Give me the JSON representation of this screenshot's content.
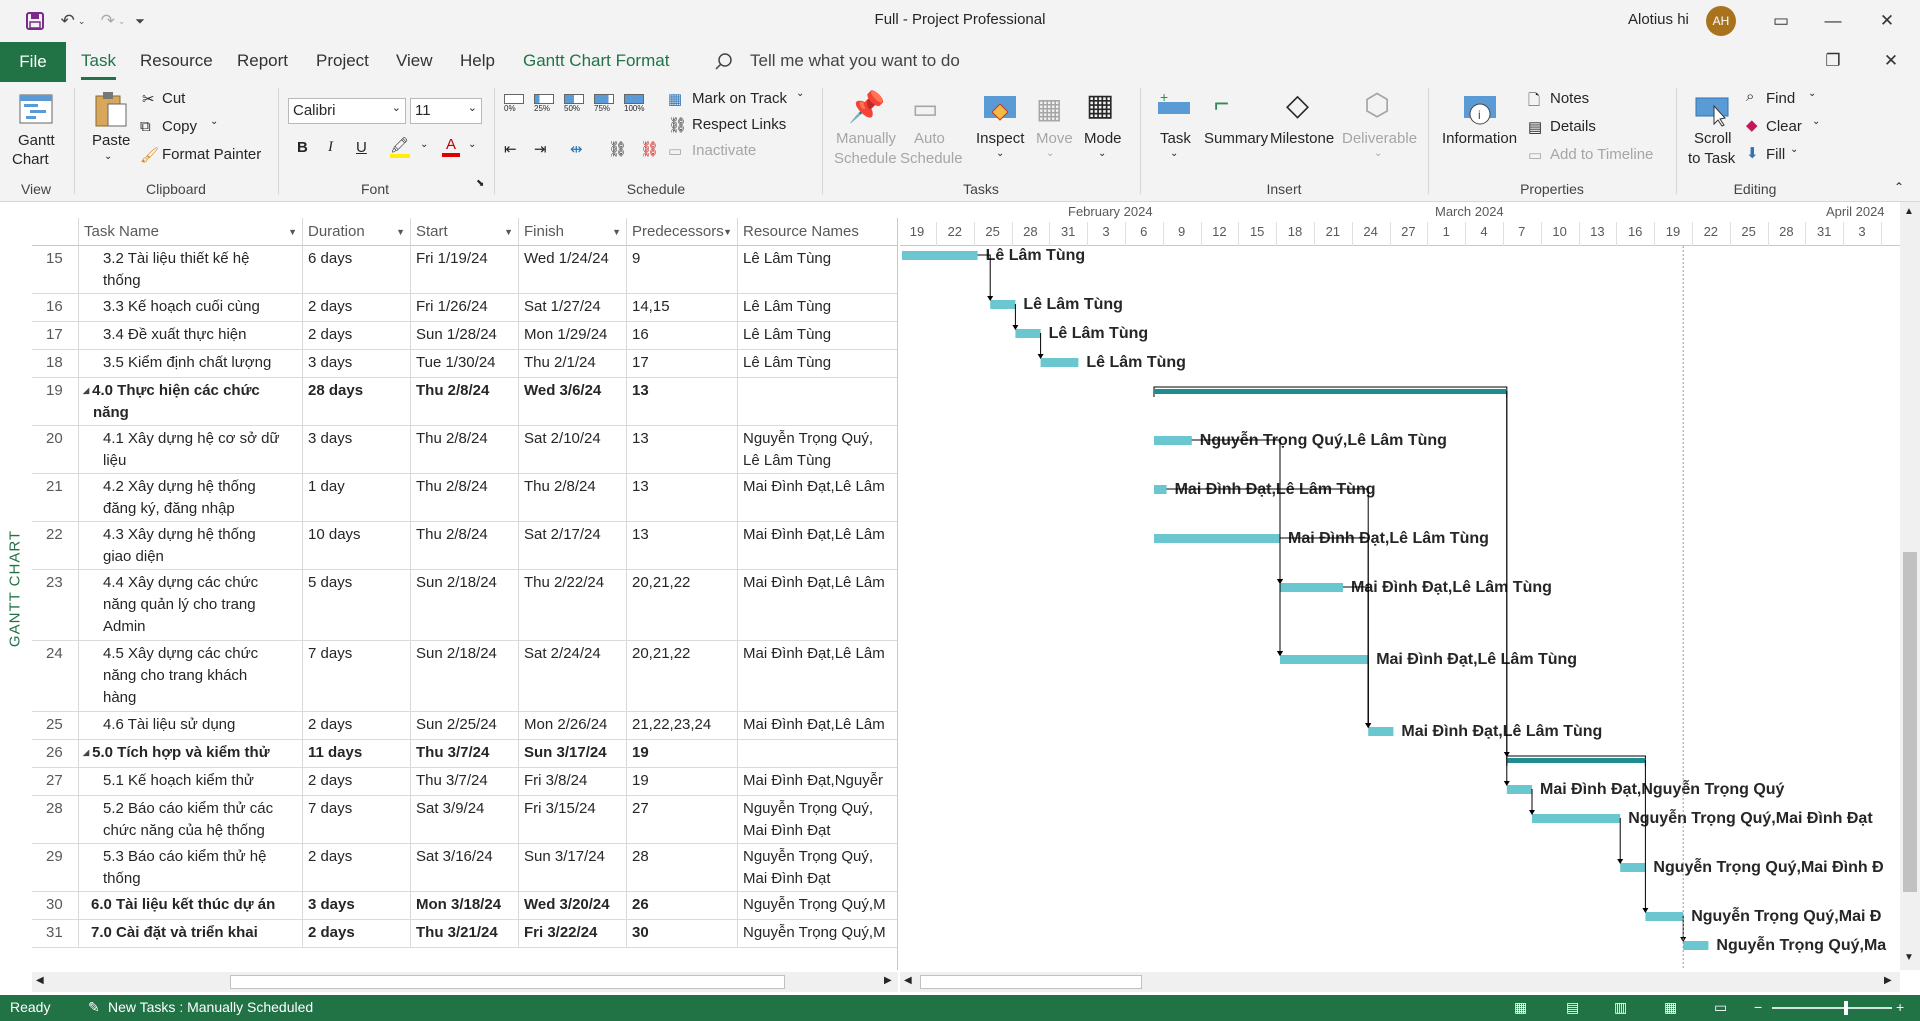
{
  "window": {
    "title": "Full  -  Project Professional",
    "user": "Alotius hi",
    "avatar_initials": "AH"
  },
  "menu": {
    "file": "File",
    "tabs": [
      "Task",
      "Resource",
      "Report",
      "Project",
      "View",
      "Help",
      "Gantt Chart Format"
    ],
    "tell_me": "Tell me what you want to do"
  },
  "ribbon": {
    "view": {
      "gantt_chart": "Gantt",
      "gantt_chart2": "Chart",
      "label": "View"
    },
    "clipboard": {
      "paste": "Paste",
      "cut": "Cut",
      "copy": "Copy",
      "format_painter": "Format Painter",
      "label": "Clipboard"
    },
    "font": {
      "name": "Calibri",
      "size": "11",
      "bold": "B",
      "italic": "I",
      "underline": "U",
      "label": "Font"
    },
    "schedule": {
      "pcts": [
        "0%",
        "25%",
        "50%",
        "75%",
        "100%"
      ],
      "mark_on_track": "Mark on Track",
      "respect_links": "Respect Links",
      "inactivate": "Inactivate",
      "label": "Schedule"
    },
    "tasks": {
      "manually_schedule": [
        "Manually",
        "Schedule"
      ],
      "auto_schedule": [
        "Auto",
        "Schedule"
      ],
      "inspect": "Inspect",
      "move": "Move",
      "mode": "Mode",
      "label": "Tasks"
    },
    "insert": {
      "task": "Task",
      "summary": "Summary",
      "milestone": "Milestone",
      "deliverable": "Deliverable",
      "label": "Insert"
    },
    "properties": {
      "information": "Information",
      "notes": "Notes",
      "details": "Details",
      "add_to_timeline": "Add to Timeline",
      "label": "Properties"
    },
    "editing": {
      "scroll": [
        "Scroll",
        "to Task"
      ],
      "find": "Find",
      "clear": "Clear",
      "fill": "Fill",
      "label": "Editing"
    }
  },
  "side_label": "GANTT CHART",
  "table": {
    "headers": [
      "Task Name",
      "Duration",
      "Start",
      "Finish",
      "Predecessors",
      "Resource Names"
    ],
    "rows": [
      {
        "id": "15",
        "name": [
          "3.2 Tài liệu thiết kế hệ",
          "thống"
        ],
        "dur": "6 days",
        "start": "Fri 1/19/24",
        "finish": "Wed 1/24/24",
        "pred": "9",
        "res": [
          "Lê Lâm Tùng"
        ]
      },
      {
        "id": "16",
        "name": [
          "3.3 Kế hoạch cuối cùng"
        ],
        "dur": "2 days",
        "start": "Fri 1/26/24",
        "finish": "Sat 1/27/24",
        "pred": "14,15",
        "res": [
          "Lê Lâm Tùng"
        ]
      },
      {
        "id": "17",
        "name": [
          "3.4 Đề xuất thực hiện"
        ],
        "dur": "2 days",
        "start": "Sun 1/28/24",
        "finish": "Mon 1/29/24",
        "pred": "16",
        "res": [
          "Lê Lâm Tùng"
        ]
      },
      {
        "id": "18",
        "name": [
          "3.5 Kiểm định chất lượng"
        ],
        "dur": "3 days",
        "start": "Tue 1/30/24",
        "finish": "Thu 2/1/24",
        "pred": "17",
        "res": [
          "Lê Lâm Tùng"
        ]
      },
      {
        "id": "19",
        "summary": true,
        "name": [
          "4.0 Thực hiện các chức",
          "năng"
        ],
        "dur": "28 days",
        "start": "Thu 2/8/24",
        "finish": "Wed 3/6/24",
        "pred": "13",
        "res": [
          ""
        ]
      },
      {
        "id": "20",
        "name": [
          "4.1 Xây dựng hệ cơ sở dữ",
          "liệu"
        ],
        "dur": "3 days",
        "start": "Thu 2/8/24",
        "finish": "Sat 2/10/24",
        "pred": "13",
        "res": [
          "Nguyễn Trọng Quý,",
          "Lê Lâm Tùng"
        ]
      },
      {
        "id": "21",
        "name": [
          "4.2 Xây dựng hệ thống",
          "đăng ký, đăng nhập"
        ],
        "dur": "1 day",
        "start": "Thu 2/8/24",
        "finish": "Thu 2/8/24",
        "pred": "13",
        "res": [
          "Mai Đình Đạt,Lê Lâm"
        ]
      },
      {
        "id": "22",
        "name": [
          "4.3 Xây dựng hệ thống",
          "giao diện"
        ],
        "dur": "10 days",
        "start": "Thu 2/8/24",
        "finish": "Sat 2/17/24",
        "pred": "13",
        "res": [
          "Mai Đình Đạt,Lê Lâm"
        ]
      },
      {
        "id": "23",
        "name": [
          "4.4 Xây dựng các chức",
          "năng quản lý cho trang",
          "Admin"
        ],
        "dur": "5 days",
        "start": "Sun 2/18/24",
        "finish": "Thu 2/22/24",
        "pred": "20,21,22",
        "res": [
          "Mai Đình Đạt,Lê Lâm"
        ]
      },
      {
        "id": "24",
        "name": [
          "4.5 Xây dựng các chức",
          "năng cho trang khách",
          "hàng"
        ],
        "dur": "7 days",
        "start": "Sun 2/18/24",
        "finish": "Sat 2/24/24",
        "pred": "20,21,22",
        "res": [
          "Mai Đình Đạt,Lê Lâm"
        ]
      },
      {
        "id": "25",
        "name": [
          "4.6 Tài liệu sử dụng"
        ],
        "dur": "2 days",
        "start": "Sun 2/25/24",
        "finish": "Mon 2/26/24",
        "pred": "21,22,23,24",
        "res": [
          "Mai Đình Đạt,Lê Lâm"
        ]
      },
      {
        "id": "26",
        "summary": true,
        "name": [
          "5.0 Tích hợp và kiểm thử"
        ],
        "dur": "11 days",
        "start": "Thu 3/7/24",
        "finish": "Sun 3/17/24",
        "pred": "19",
        "res": [
          ""
        ]
      },
      {
        "id": "27",
        "name": [
          "5.1 Kế hoạch kiểm thử"
        ],
        "dur": "2 days",
        "start": "Thu 3/7/24",
        "finish": "Fri 3/8/24",
        "pred": "19",
        "res": [
          "Mai Đình Đạt,Nguyễr"
        ]
      },
      {
        "id": "28",
        "name": [
          "5.2 Báo cáo kiểm thử các",
          "chức năng của hệ thống"
        ],
        "dur": "7 days",
        "start": "Sat 3/9/24",
        "finish": "Fri 3/15/24",
        "pred": "27",
        "res": [
          "Nguyễn Trọng Quý,",
          "Mai Đình Đạt"
        ]
      },
      {
        "id": "29",
        "name": [
          "5.3 Báo cáo kiểm thử hệ",
          "thống"
        ],
        "dur": "2 days",
        "start": "Sat 3/16/24",
        "finish": "Sun 3/17/24",
        "pred": "28",
        "res": [
          "Nguyễn Trọng Quý,",
          "Mai Đình Đạt"
        ]
      },
      {
        "id": "30",
        "summary": true,
        "nocollapse": true,
        "name": [
          "6.0 Tài liệu kết thúc dự án"
        ],
        "dur": "3 days",
        "start": "Mon 3/18/24",
        "finish": "Wed 3/20/24",
        "pred": "26",
        "res": [
          "Nguyễn Trọng Quý,M"
        ]
      },
      {
        "id": "31",
        "summary": true,
        "nocollapse": true,
        "name": [
          "7.0 Cài đặt và triển khai"
        ],
        "dur": "2 days",
        "start": "Thu 3/21/24",
        "finish": "Fri 3/22/24",
        "pred": "30",
        "res": [
          "Nguyễn Trọng Quý,M"
        ]
      }
    ]
  },
  "timeline": {
    "months": [
      "February 2024",
      "March 2024",
      "April 2024"
    ],
    "days": [
      "19",
      "22",
      "25",
      "28",
      "31",
      "3",
      "6",
      "9",
      "12",
      "15",
      "18",
      "21",
      "24",
      "27",
      "1",
      "4",
      "7",
      "10",
      "13",
      "16",
      "19",
      "22",
      "25",
      "28",
      "31",
      "3"
    ],
    "bar_labels": [
      "Lê Lâm Tùng",
      "Lê Lâm Tùng",
      "Lê Lâm Tùng",
      "Lê Lâm Tùng",
      "",
      "Nguyễn Trọng Quý,Lê Lâm Tùng",
      "Mai Đình Đạt,Lê Lâm Tùng",
      "Mai Đình Đạt,Lê Lâm Tùng",
      "Mai Đình Đạt,Lê Lâm Tùng",
      "Mai Đình Đạt,Lê Lâm Tùng",
      "Mai Đình Đạt,Lê Lâm Tùng",
      "",
      "Mai Đình Đạt,Nguyễn Trọng Quý",
      "Nguyễn Trọng Quý,Mai Đình Đạt",
      "Nguyễn Trọng Quý,Mai Đình Đ",
      "Nguyễn Trọng Quý,Mai Đ",
      "Nguyễn Trọng Quý,Ma"
    ],
    "colors": {
      "task": "#6ac7cf",
      "summary": "#1f8c8f"
    }
  },
  "status": {
    "ready": "Ready",
    "new_tasks": "New Tasks : Manually Scheduled"
  }
}
